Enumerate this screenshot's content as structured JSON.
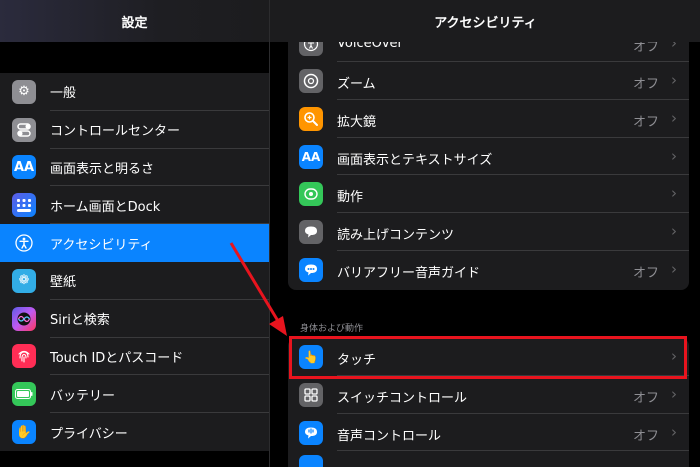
{
  "sidebar": {
    "title": "設定",
    "items": [
      {
        "label": "一般",
        "icon": "gear-icon"
      },
      {
        "label": "コントロールセンター",
        "icon": "toggles-icon"
      },
      {
        "label": "画面表示と明るさ",
        "icon": "text-size-icon",
        "glyph": "AA"
      },
      {
        "label": "ホーム画面とDock",
        "icon": "grid-icon"
      },
      {
        "label": "アクセシビリティ",
        "icon": "accessibility-icon",
        "selected": true
      },
      {
        "label": "壁紙",
        "icon": "flower-icon"
      },
      {
        "label": "Siriと検索",
        "icon": "siri-icon"
      },
      {
        "label": "Touch IDとパスコード",
        "icon": "fingerprint-icon"
      },
      {
        "label": "バッテリー",
        "icon": "battery-icon"
      },
      {
        "label": "プライバシー",
        "icon": "hand-icon"
      }
    ]
  },
  "detail": {
    "title": "アクセシビリティ",
    "vision_items": [
      {
        "label": "VoiceOver",
        "value": "オフ",
        "icon": "voiceover-icon"
      },
      {
        "label": "ズーム",
        "value": "オフ",
        "icon": "zoom-icon"
      },
      {
        "label": "拡大鏡",
        "value": "オフ",
        "icon": "magnifier-icon"
      },
      {
        "label": "画面表示とテキストサイズ",
        "value": "",
        "icon": "text-size-icon",
        "glyph": "AA"
      },
      {
        "label": "動作",
        "value": "",
        "icon": "motion-icon"
      },
      {
        "label": "読み上げコンテンツ",
        "value": "",
        "icon": "speech-icon"
      },
      {
        "label": "バリアフリー音声ガイド",
        "value": "オフ",
        "icon": "audio-description-icon"
      }
    ],
    "section_label": "身体および動作",
    "physical_items": [
      {
        "label": "タッチ",
        "value": "",
        "icon": "touch-hand-icon"
      },
      {
        "label": "スイッチコントロール",
        "value": "オフ",
        "icon": "switch-grid-icon"
      },
      {
        "label": "音声コントロール",
        "value": "オフ",
        "icon": "voice-control-icon"
      }
    ]
  },
  "highlight_color": "#e8141e",
  "accent_color": "#0a84ff"
}
